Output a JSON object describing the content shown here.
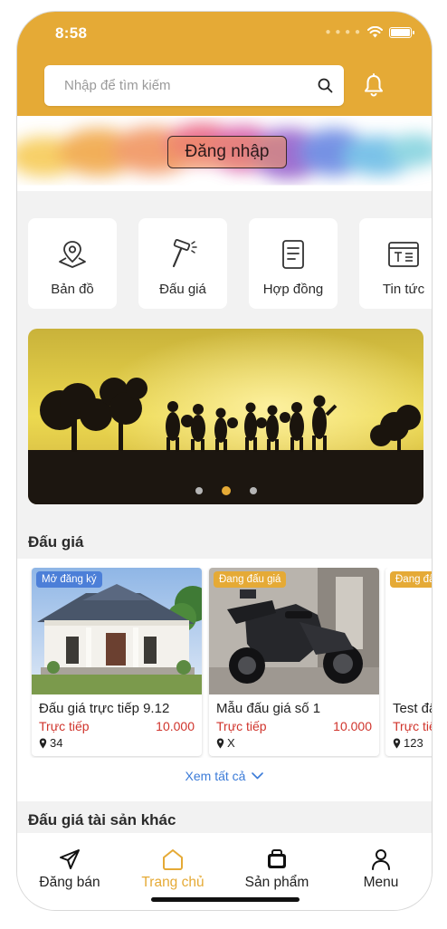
{
  "status": {
    "time": "8:58"
  },
  "search": {
    "placeholder": "Nhập để tìm kiếm"
  },
  "banner": {
    "login_label": "Đăng nhập"
  },
  "quick_menu": [
    {
      "label": "Bản đồ",
      "icon": "map-pin-icon"
    },
    {
      "label": "Đấu giá",
      "icon": "hammer-icon"
    },
    {
      "label": "Hợp đồng",
      "icon": "document-icon"
    },
    {
      "label": "Tin tức",
      "icon": "news-icon"
    }
  ],
  "slider": {
    "total": 3,
    "active_index": 1
  },
  "auction": {
    "title": "Đấu giá",
    "cards": [
      {
        "badge": "Mở đăng ký",
        "badge_color": "#4c7fd8",
        "title": "Đấu giá trực tiếp 9.12",
        "type": "Trực tiếp",
        "price": "10.000",
        "location": "34"
      },
      {
        "badge": "Đang đấu giá",
        "badge_color": "#e5aa36",
        "title": "Mẫu đấu giá số 1",
        "type": "Trực tiếp",
        "price": "10.000",
        "location": "X"
      },
      {
        "badge": "Đang đấu giá",
        "badge_color": "#e5aa36",
        "title": "Test đấu giá",
        "type": "Trực tiếp",
        "price": "",
        "location": "123"
      }
    ],
    "see_all": "Xem tất cả"
  },
  "other_section": {
    "title": "Đấu giá tài sản khác"
  },
  "tabbar": [
    {
      "label": "Đăng bán",
      "icon": "send-icon",
      "active": false
    },
    {
      "label": "Trang chủ",
      "icon": "home-icon",
      "active": true
    },
    {
      "label": "Sản phẩm",
      "icon": "product-icon",
      "active": false
    },
    {
      "label": "Menu",
      "icon": "user-icon",
      "active": false
    }
  ],
  "colors": {
    "brand": "#e5aa36",
    "price": "#d0342c",
    "link": "#3b7bd8",
    "badge_open": "#4c7fd8"
  }
}
